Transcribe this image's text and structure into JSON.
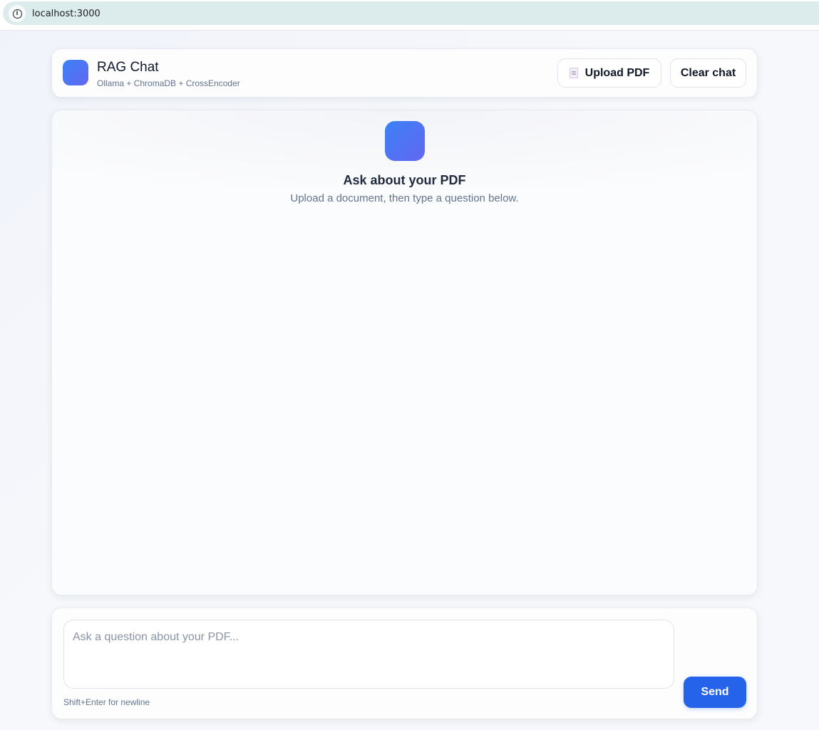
{
  "browser": {
    "url": "localhost:3000",
    "info_icon": "info-icon"
  },
  "header": {
    "logo_icon": "app-logo-icon",
    "title": "RAG Chat",
    "subtitle": "Ollama + ChromaDB + CrossEncoder",
    "upload_label": "Upload PDF",
    "upload_icon": "file-icon",
    "clear_label": "Clear chat"
  },
  "chat": {
    "empty_icon": "app-logo-icon",
    "empty_title": "Ask about your PDF",
    "empty_subtitle": "Upload a document, then type a question below."
  },
  "composer": {
    "placeholder": "Ask a question about your PDF...",
    "value": "",
    "hint": "Shift+Enter for newline",
    "send_label": "Send"
  },
  "colors": {
    "accent": "#2563eb",
    "logo_gradient_start": "#3b82f6",
    "logo_gradient_end": "#6366f1",
    "address_bar": "#dcebeb"
  }
}
